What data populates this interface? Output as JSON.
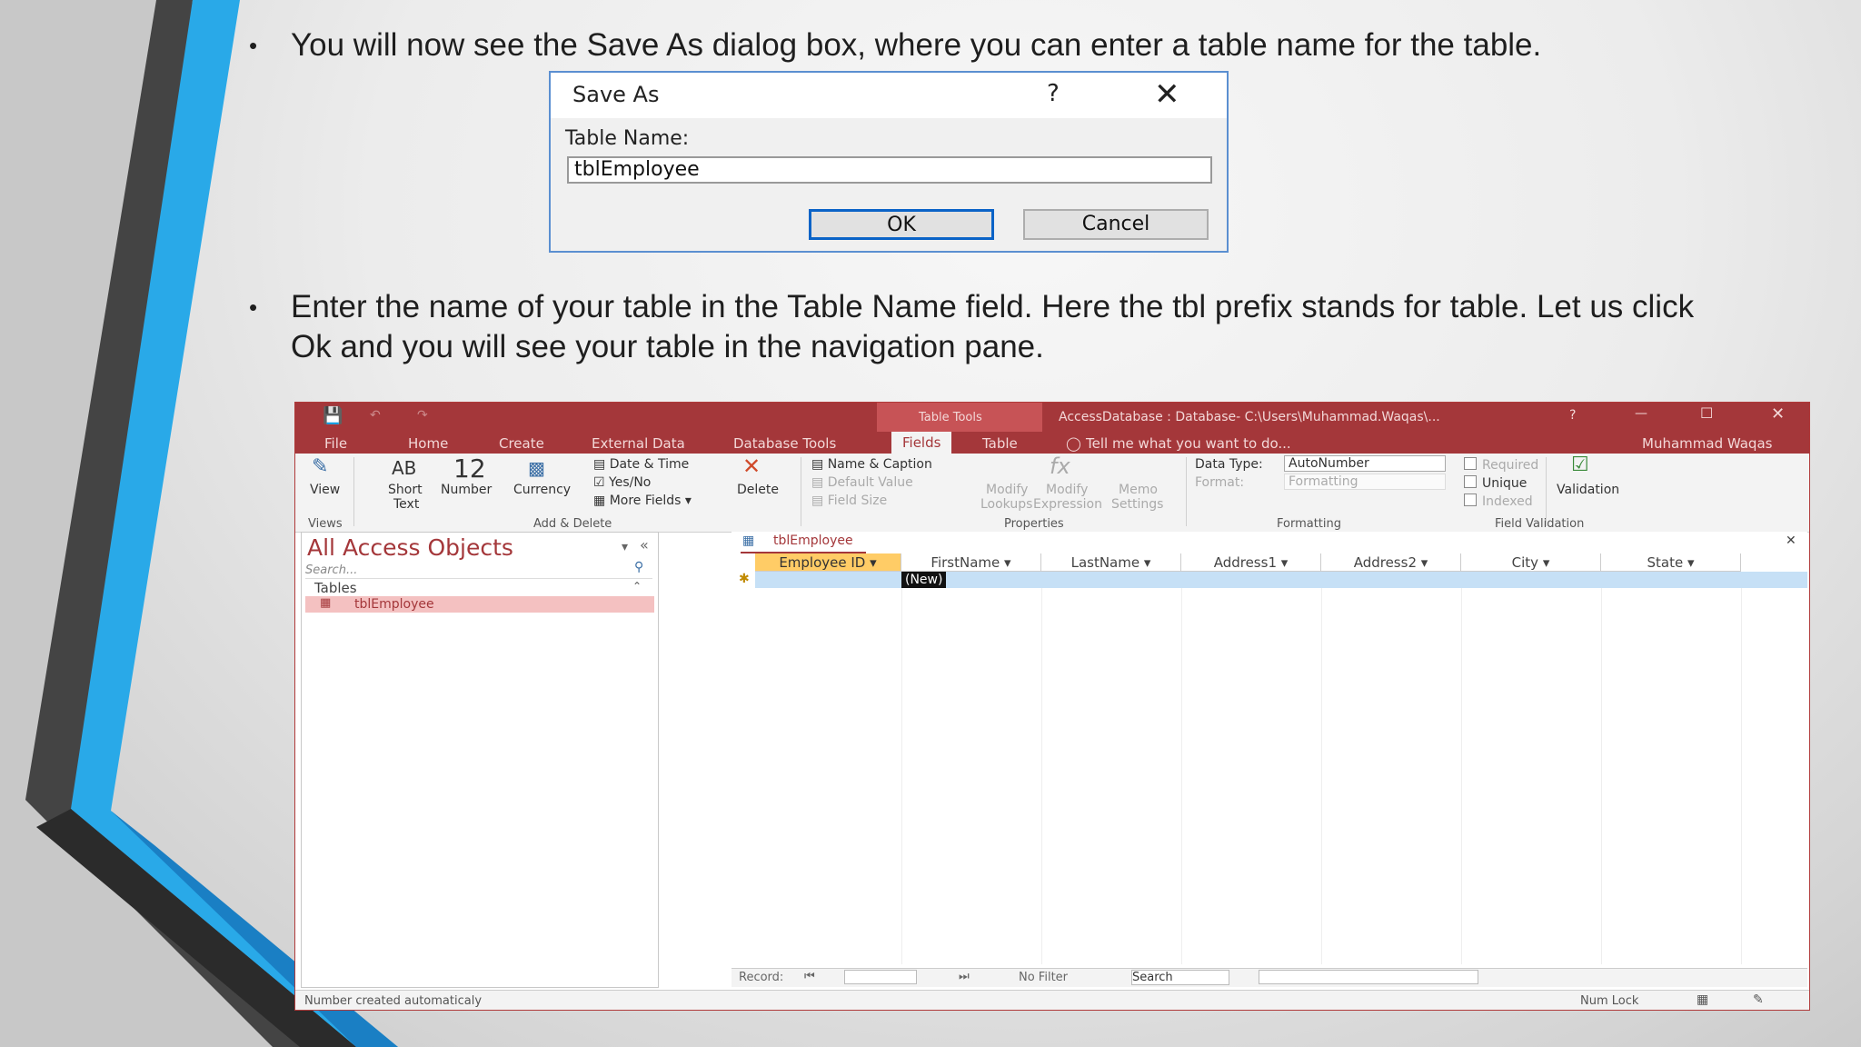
{
  "slide": {
    "bullet1": "You will now see the Save As dialog box, where you can enter a table name for the table.",
    "bullet2_line1": "Enter the name of your table in the Table Name field. Here the tbl prefix stands for table. Let us click",
    "bullet2_line2": "Ok and you will see your table in the navigation pane.",
    "bullet_char": "•"
  },
  "dialog": {
    "title": "Save As",
    "help": "?",
    "close": "✕",
    "label": "Table Name:",
    "value": "tblEmployee",
    "ok": "OK",
    "cancel": "Cancel"
  },
  "access": {
    "context_tools": "Table Tools",
    "window_title": "AccessDatabase : Database- C:\\Users\\Muhammad.Waqas\\...",
    "help": "?",
    "user": "Muhammad Waqas",
    "tabs": [
      "File",
      "Home",
      "Create",
      "External Data",
      "Database Tools",
      "Fields",
      "Table"
    ],
    "tell_me": "Tell me what you want to do...",
    "ribbon": {
      "view": "View",
      "views_group": "Views",
      "short_text_icon": "AB",
      "short_text": "Short",
      "short_text2": "Text",
      "number_icon": "12",
      "number": "Number",
      "currency": "Currency",
      "date_time": "Date & Time",
      "yes_no": "Yes/No",
      "more_fields": "More Fields",
      "delete": "Delete",
      "add_delete_group": "Add & Delete",
      "name_caption": "Name & Caption",
      "default_value": "Default Value",
      "field_size": "Field Size",
      "modify_lookups": "Modify",
      "modify_lookups2": "Lookups",
      "modify_expression": "Modify",
      "modify_expression2": "Expression",
      "memo_settings": "Memo",
      "memo_settings2": "Settings",
      "properties_group": "Properties",
      "data_type_label": "Data Type:",
      "data_type_value": "AutoNumber",
      "format_label": "Format:",
      "format_value": "Formatting",
      "formatting_group": "Formatting",
      "required": "Required",
      "unique": "Unique",
      "indexed": "Indexed",
      "validation": "Validation",
      "field_validation_group": "Field Validation"
    },
    "nav": {
      "header": "All Access Objects",
      "search": "Search...",
      "group": "Tables",
      "item": "tblEmployee"
    },
    "sheet": {
      "tab": "tblEmployee",
      "columns": [
        "Employee ID",
        "FirstName",
        "LastName",
        "Address1",
        "Address2",
        "City",
        "State"
      ],
      "new_row": "(New)",
      "record_label": "Record:",
      "no_filter": "No Filter",
      "search": "Search"
    },
    "status": {
      "left": "Number created automaticaly",
      "num_lock": "Num Lock"
    }
  },
  "colors": {
    "access_red": "#a4373a",
    "slide_blue": "#29a9e8",
    "slide_dark": "#3c3c3c"
  }
}
